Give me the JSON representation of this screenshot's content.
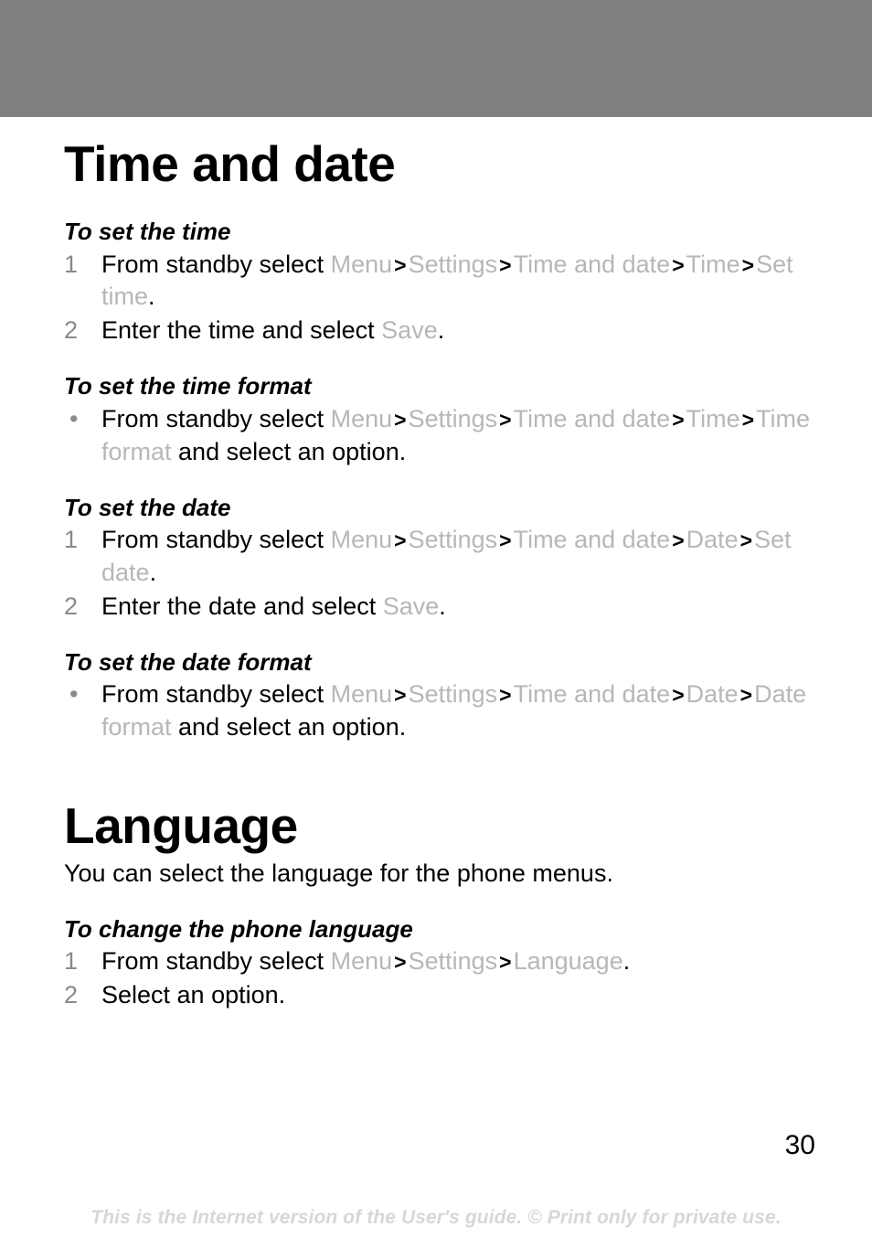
{
  "page": {
    "number": "30",
    "footer_note": "This is the Internet version of the User's guide. © Print only for private use.",
    "header_bar_color": "#808080",
    "menu_path_color": "#b7b7b7",
    "marker_color": "#8a8a8a"
  },
  "sections": [
    {
      "title": "Time and date",
      "intro": "",
      "procedures": [
        {
          "title": "To set the time",
          "type": "ordered",
          "steps": [
            {
              "marker": "1",
              "parts": [
                {
                  "kind": "text",
                  "value": "From standby select "
                },
                {
                  "kind": "path",
                  "value": "Menu"
                },
                {
                  "kind": "sep",
                  "value": ">"
                },
                {
                  "kind": "path",
                  "value": "Settings"
                },
                {
                  "kind": "sep",
                  "value": ">"
                },
                {
                  "kind": "path",
                  "value": "Time and date"
                },
                {
                  "kind": "sep",
                  "value": ">"
                },
                {
                  "kind": "path",
                  "value": "Time"
                },
                {
                  "kind": "sep",
                  "value": ">"
                },
                {
                  "kind": "path",
                  "value": "Set time"
                },
                {
                  "kind": "text",
                  "value": "."
                }
              ]
            },
            {
              "marker": "2",
              "parts": [
                {
                  "kind": "text",
                  "value": "Enter the time and select "
                },
                {
                  "kind": "path",
                  "value": "Save"
                },
                {
                  "kind": "text",
                  "value": "."
                }
              ]
            }
          ]
        },
        {
          "title": "To set the time format",
          "type": "bulleted",
          "steps": [
            {
              "marker": "•",
              "parts": [
                {
                  "kind": "text",
                  "value": "From standby select "
                },
                {
                  "kind": "path",
                  "value": "Menu"
                },
                {
                  "kind": "sep",
                  "value": ">"
                },
                {
                  "kind": "path",
                  "value": "Settings"
                },
                {
                  "kind": "sep",
                  "value": ">"
                },
                {
                  "kind": "path",
                  "value": "Time and date"
                },
                {
                  "kind": "sep",
                  "value": ">"
                },
                {
                  "kind": "path",
                  "value": "Time"
                },
                {
                  "kind": "sep",
                  "value": ">"
                },
                {
                  "kind": "path",
                  "value": "Time format"
                },
                {
                  "kind": "text",
                  "value": " and select an option."
                }
              ]
            }
          ]
        },
        {
          "title": "To set the date",
          "type": "ordered",
          "steps": [
            {
              "marker": "1",
              "parts": [
                {
                  "kind": "text",
                  "value": "From standby select "
                },
                {
                  "kind": "path",
                  "value": "Menu"
                },
                {
                  "kind": "sep",
                  "value": ">"
                },
                {
                  "kind": "path",
                  "value": "Settings"
                },
                {
                  "kind": "sep",
                  "value": ">"
                },
                {
                  "kind": "path",
                  "value": "Time and date"
                },
                {
                  "kind": "sep",
                  "value": ">"
                },
                {
                  "kind": "path",
                  "value": "Date"
                },
                {
                  "kind": "sep",
                  "value": ">"
                },
                {
                  "kind": "path",
                  "value": "Set date"
                },
                {
                  "kind": "text",
                  "value": "."
                }
              ]
            },
            {
              "marker": "2",
              "parts": [
                {
                  "kind": "text",
                  "value": "Enter the date and select "
                },
                {
                  "kind": "path",
                  "value": "Save"
                },
                {
                  "kind": "text",
                  "value": "."
                }
              ]
            }
          ]
        },
        {
          "title": "To set the date format",
          "type": "bulleted",
          "steps": [
            {
              "marker": "•",
              "parts": [
                {
                  "kind": "text",
                  "value": "From standby select "
                },
                {
                  "kind": "path",
                  "value": "Menu"
                },
                {
                  "kind": "sep",
                  "value": ">"
                },
                {
                  "kind": "path",
                  "value": "Settings"
                },
                {
                  "kind": "sep",
                  "value": ">"
                },
                {
                  "kind": "path",
                  "value": "Time and date"
                },
                {
                  "kind": "sep",
                  "value": ">"
                },
                {
                  "kind": "path",
                  "value": "Date"
                },
                {
                  "kind": "sep",
                  "value": ">"
                },
                {
                  "kind": "path",
                  "value": "Date format"
                },
                {
                  "kind": "text",
                  "value": " and select an option."
                }
              ]
            }
          ]
        }
      ]
    },
    {
      "title": "Language",
      "intro": "You can select the language for the phone menus.",
      "procedures": [
        {
          "title": "To change the phone language",
          "type": "ordered",
          "steps": [
            {
              "marker": "1",
              "parts": [
                {
                  "kind": "text",
                  "value": "From standby select "
                },
                {
                  "kind": "path",
                  "value": "Menu"
                },
                {
                  "kind": "sep",
                  "value": ">"
                },
                {
                  "kind": "path",
                  "value": "Settings"
                },
                {
                  "kind": "sep",
                  "value": ">"
                },
                {
                  "kind": "path",
                  "value": "Language"
                },
                {
                  "kind": "text",
                  "value": "."
                }
              ]
            },
            {
              "marker": "2",
              "parts": [
                {
                  "kind": "text",
                  "value": "Select an option."
                }
              ]
            }
          ]
        }
      ]
    }
  ]
}
